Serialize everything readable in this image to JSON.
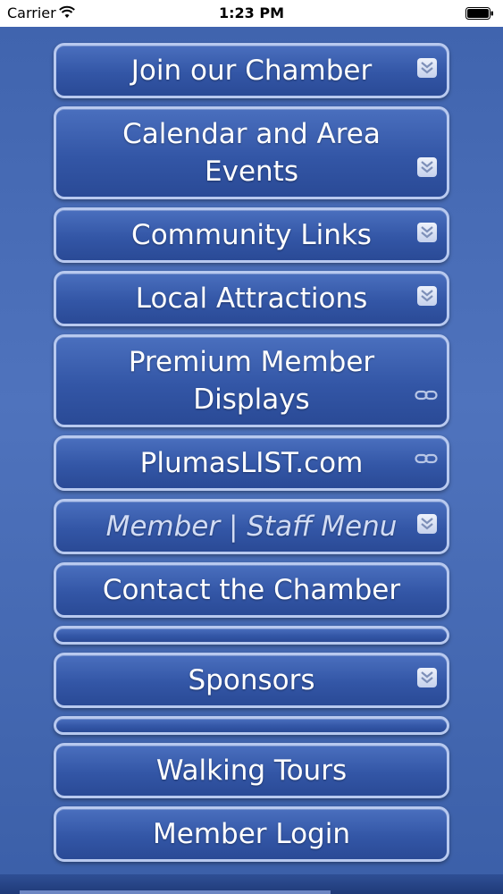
{
  "status_bar": {
    "carrier": "Carrier",
    "time": "1:23 PM"
  },
  "colors": {
    "background": "#4a6db8",
    "button_fill": "#3356a6",
    "button_border": "#b8c9ef",
    "text": "#ffffff"
  },
  "menu": {
    "items": [
      {
        "label": "Join our Chamber",
        "icon": "chevron-down-double-icon"
      },
      {
        "label": "Calendar and Area Events",
        "icon": "chevron-down-double-icon"
      },
      {
        "label": "Community Links",
        "icon": "chevron-down-double-icon"
      },
      {
        "label": "Local Attractions",
        "icon": "chevron-down-double-icon"
      },
      {
        "label": "Premium Member Displays",
        "icon": "link-icon"
      },
      {
        "label": "PlumasLIST.com",
        "icon": "link-icon"
      },
      {
        "label": "Member | Staff Menu",
        "icon": "chevron-down-double-icon"
      },
      {
        "label": "Contact the Chamber",
        "icon": ""
      },
      {
        "label": "",
        "icon": ""
      },
      {
        "label": "Sponsors",
        "icon": "chevron-down-double-icon"
      },
      {
        "label": "",
        "icon": ""
      },
      {
        "label": "Walking Tours",
        "icon": ""
      },
      {
        "label": "Member Login",
        "icon": ""
      }
    ]
  }
}
